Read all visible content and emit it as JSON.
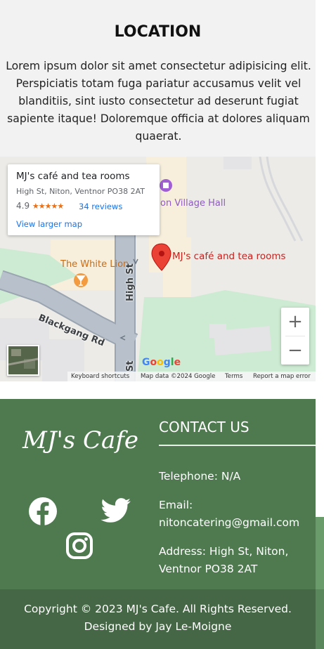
{
  "location": {
    "heading": "LOCATION",
    "body": "Lorem ipsum dolor sit amet consectetur adipisicing elit. Perspiciatis totam fuga pariatur accusamus velit vel blanditiis, sint iusto consectetur ad deserunt fugiat sapiente itaque! Doloremque officia at dolores aliquam quaerat."
  },
  "map": {
    "place_name": "MJ's café and tea rooms",
    "place_address": "High St, Niton, Ventnor PO38 2AT",
    "rating": "4.9",
    "stars": "★★★★★",
    "reviews": "34 reviews",
    "view_larger": "View larger map",
    "marker_label": "MJ's café and tea rooms",
    "poi_white_lion": "The White Lion",
    "poi_village_hall": "on Village Hall",
    "road_blackgang": "Blackgang Rd",
    "road_high_st": "High St",
    "road_st": "St",
    "zoom_in": "+",
    "zoom_out": "−",
    "attr_shortcuts": "Keyboard shortcuts",
    "attr_data": "Map data ©2024 Google",
    "attr_terms": "Terms",
    "attr_report": "Report a map error",
    "google": [
      "G",
      "o",
      "o",
      "g",
      "l",
      "e"
    ],
    "google_colors": [
      "#4285f4",
      "#ea4335",
      "#fbbc05",
      "#4285f4",
      "#34a853",
      "#ea4335"
    ]
  },
  "footer": {
    "logo": "MJ's Cafe",
    "social_icons": [
      "facebook-icon",
      "twitter-icon",
      "instagram-icon"
    ],
    "contact_heading": "CONTACT US",
    "telephone": "Telephone: N/A",
    "email_label": "Email:",
    "email_value": "nitoncatering@gmail.com",
    "address_line1": "Address: High St, Niton,",
    "address_line2": "Ventnor PO38 2AT",
    "copyright": "Copyright © 2023 MJ's Cafe. All Rights Reserved.",
    "designed_by": "Designed by Jay Le-Moigne"
  },
  "colors": {
    "footer_bg": "#4f7a50",
    "footer_bottom_bg": "#456746",
    "map_link": "#1a73e8",
    "marker_red": "#ea4335"
  }
}
